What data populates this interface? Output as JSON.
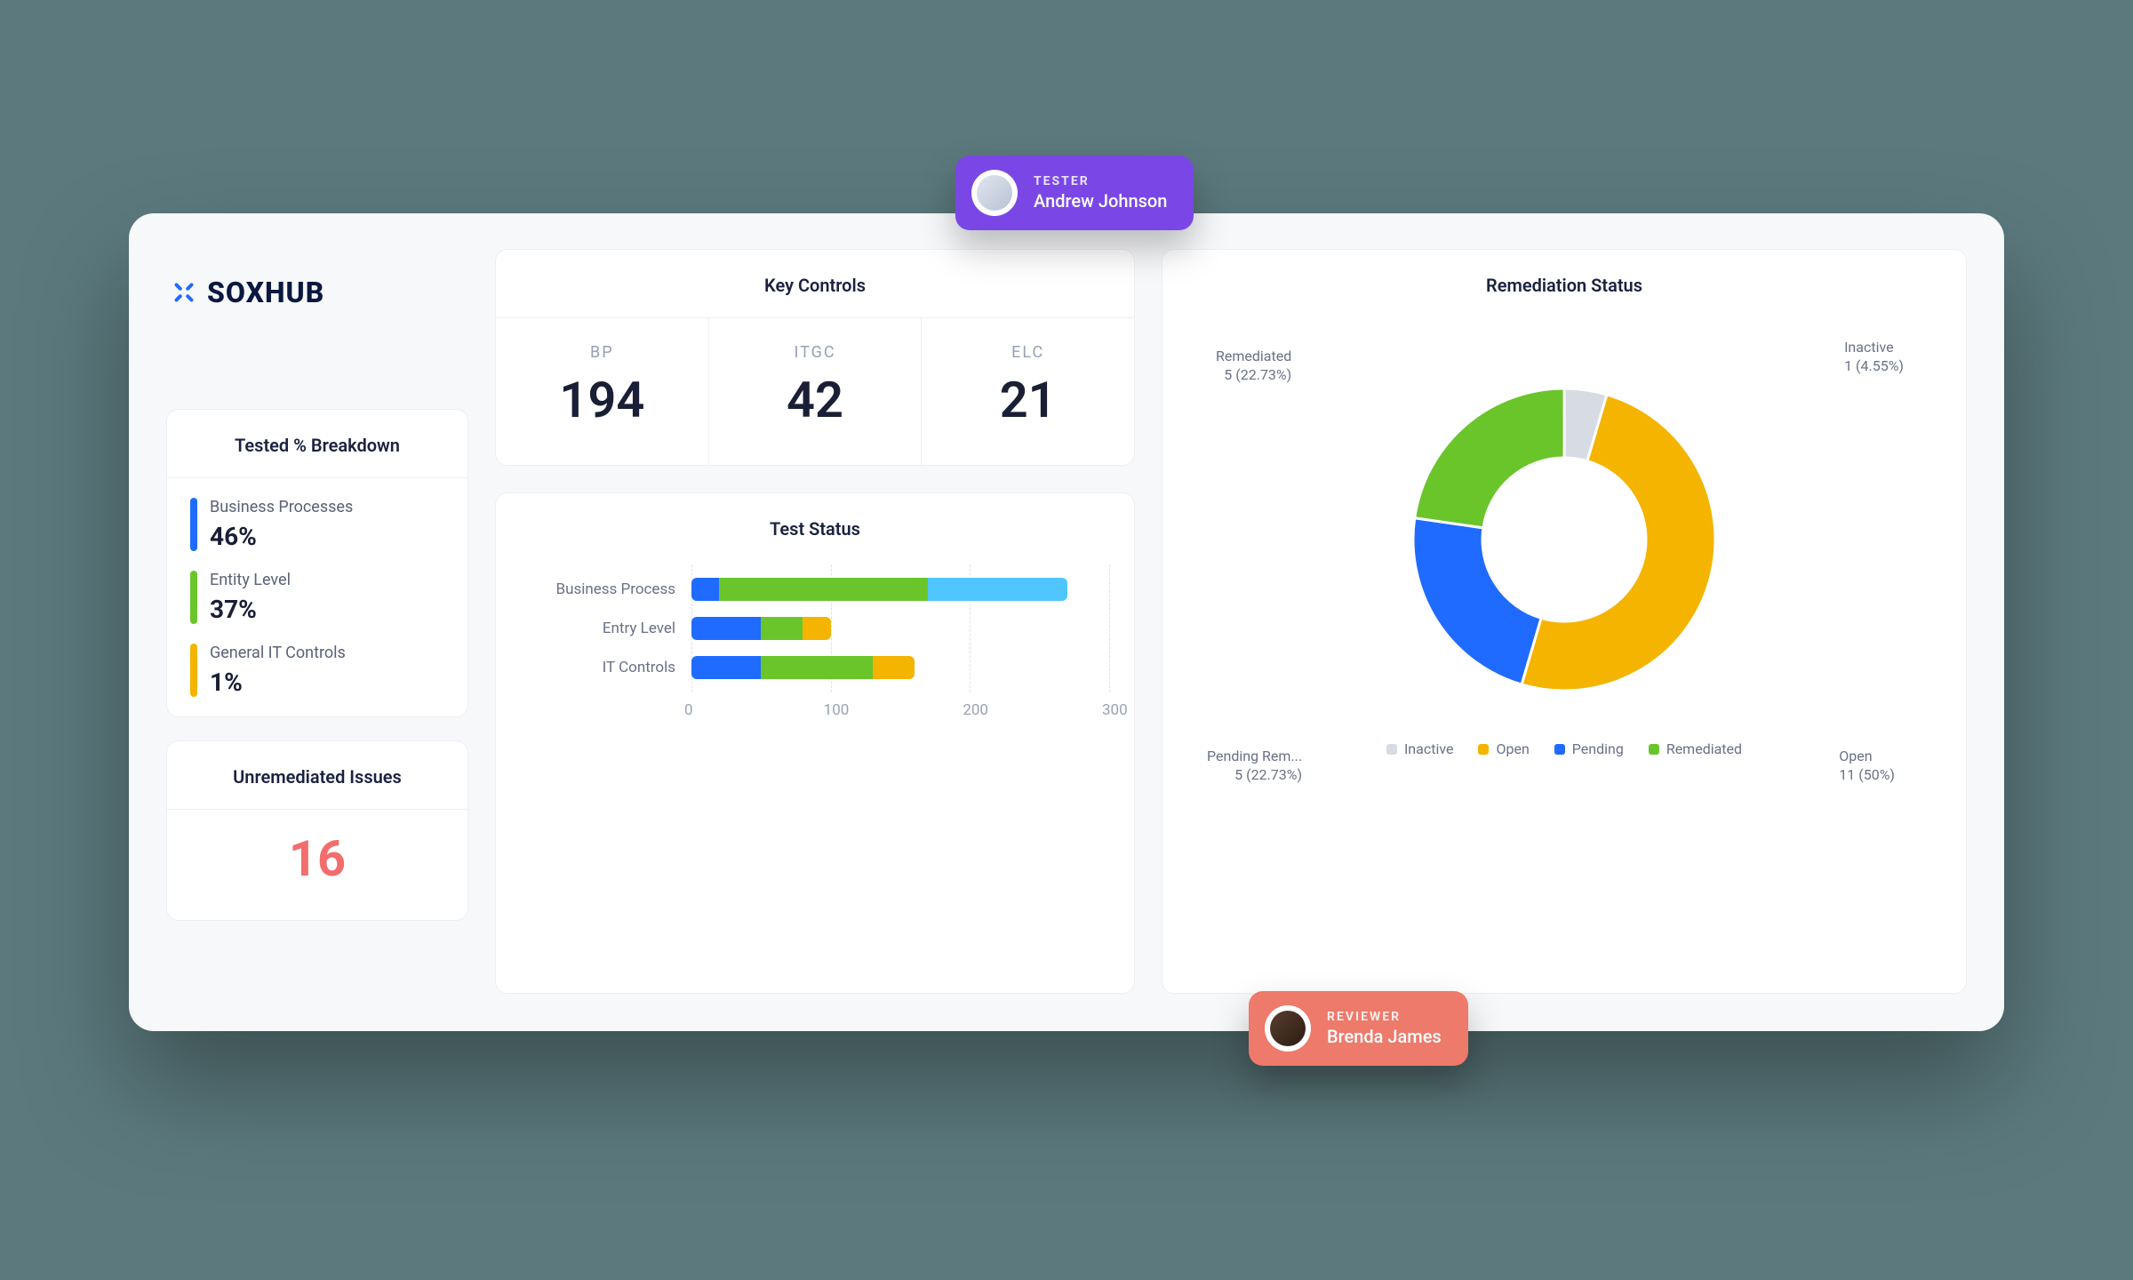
{
  "brand": {
    "name": "SOXHUB"
  },
  "colors": {
    "blue": "#1f6bff",
    "green": "#6ac52a",
    "yellow": "#f4b400",
    "lightblue": "#4fc6ff",
    "grey": "#d7dbe3",
    "coral": "#f26d6d"
  },
  "breakdown": {
    "title": "Tested % Breakdown",
    "items": [
      {
        "label": "Business Processes",
        "value": "46%",
        "color": "#1f6bff"
      },
      {
        "label": "Entity Level",
        "value": "37%",
        "color": "#6ac52a"
      },
      {
        "label": "General IT Controls",
        "value": "1%",
        "color": "#f4b400"
      }
    ]
  },
  "unremediated": {
    "title": "Unremediated Issues",
    "value": "16"
  },
  "key_controls": {
    "title": "Key Controls",
    "items": [
      {
        "label": "BP",
        "value": "194"
      },
      {
        "label": "ITGC",
        "value": "42"
      },
      {
        "label": "ELC",
        "value": "21"
      }
    ]
  },
  "test_status": {
    "title": "Test Status"
  },
  "remediation": {
    "title": "Remediation Status"
  },
  "legend": {
    "inactive": "Inactive",
    "open": "Open",
    "pending": "Pending",
    "remediated": "Remediated"
  },
  "donut_labels": {
    "remediated": {
      "line1": "Remediated",
      "line2": "5 (22.73%)"
    },
    "inactive": {
      "line1": "Inactive",
      "line2": "1 (4.55%)"
    },
    "pending": {
      "line1": "Pending Rem...",
      "line2": "5 (22.73%)"
    },
    "open": {
      "line1": "Open",
      "line2": "11 (50%)"
    }
  },
  "chips": {
    "tester": {
      "role": "TESTER",
      "name": "Andrew Johnson"
    },
    "reviewer": {
      "role": "REVIEWER",
      "name": "Brenda James"
    }
  },
  "chart_data": [
    {
      "type": "bar",
      "title": "Test Status",
      "orientation": "horizontal",
      "xlabel": "",
      "ylabel": "",
      "xlim": [
        0,
        300
      ],
      "xticks": [
        0,
        100,
        200,
        300
      ],
      "categories": [
        "Business Process",
        "Entry Level",
        "IT Controls"
      ],
      "stack_order": [
        "Pending",
        "Remediated",
        "Open",
        "Inactive"
      ],
      "series": [
        {
          "name": "Pending",
          "color": "#1f6bff",
          "values": [
            20,
            50,
            50
          ]
        },
        {
          "name": "Remediated",
          "color": "#6ac52a",
          "values": [
            150,
            30,
            80
          ]
        },
        {
          "name": "Open",
          "color": "#f4b400",
          "values": [
            0,
            20,
            30
          ]
        },
        {
          "name": "Inactive",
          "color": "#4fc6ff",
          "values": [
            100,
            0,
            0
          ]
        }
      ]
    },
    {
      "type": "pie",
      "title": "Remediation Status",
      "donut": true,
      "total": 22,
      "series": [
        {
          "name": "Inactive",
          "value": 1,
          "percent": 4.55,
          "color": "#d7dbe3"
        },
        {
          "name": "Open",
          "value": 11,
          "percent": 50.0,
          "color": "#f4b400"
        },
        {
          "name": "Pending",
          "value": 5,
          "percent": 22.73,
          "color": "#1f6bff"
        },
        {
          "name": "Remediated",
          "value": 5,
          "percent": 22.73,
          "color": "#6ac52a"
        }
      ]
    }
  ]
}
